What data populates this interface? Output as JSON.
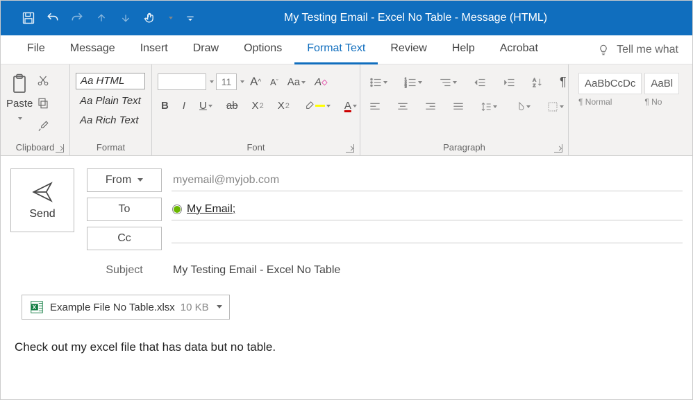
{
  "titlebar": {
    "title": "My Testing Email - Excel No Table  -  Message (HTML)"
  },
  "menu": {
    "tabs": [
      "File",
      "Message",
      "Insert",
      "Draw",
      "Options",
      "Format Text",
      "Review",
      "Help",
      "Acrobat"
    ],
    "active_index": 5,
    "tellme": "Tell me what"
  },
  "ribbon": {
    "clipboard": {
      "label": "Clipboard",
      "paste": "Paste"
    },
    "format": {
      "label": "Format",
      "html": "Aa HTML",
      "plain": "Aa Plain Text",
      "rich": "Aa Rich Text"
    },
    "font": {
      "label": "Font",
      "size": "11",
      "bold": "B",
      "italic": "I",
      "underline": "U",
      "strike": "ab",
      "sub": "X",
      "sup": "X"
    },
    "paragraph": {
      "label": "Paragraph"
    },
    "styles": {
      "sample1": "AaBbCcDc",
      "name1": "¶ Normal",
      "sample2": "AaBl",
      "name2": "¶ No"
    }
  },
  "compose": {
    "send": "Send",
    "from_label": "From",
    "from_value": "myemail@myjob.com",
    "to_label": "To",
    "to_value": "My Email;",
    "cc_label": "Cc",
    "cc_value": "",
    "subject_label": "Subject",
    "subject_value": "My Testing Email - Excel No Table"
  },
  "attachment": {
    "name": "Example File No Table.xlsx",
    "size": "10 KB"
  },
  "body": {
    "text": "Check out my excel file that has data but no table."
  }
}
